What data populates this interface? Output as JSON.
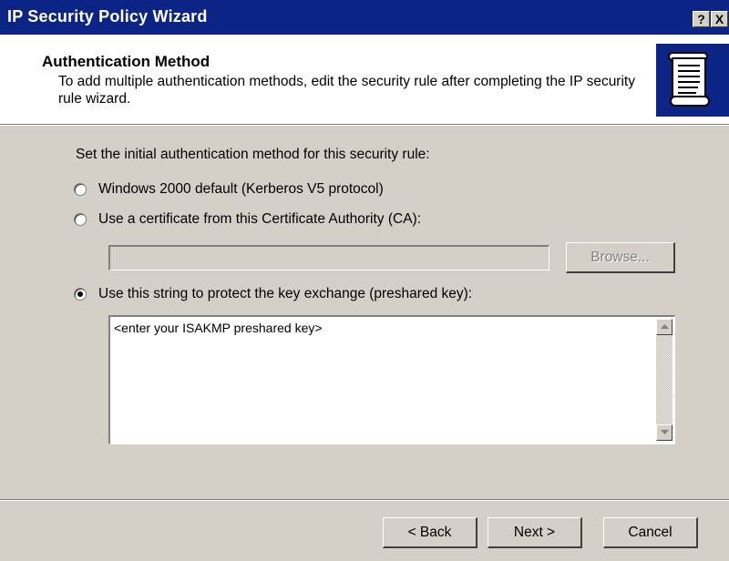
{
  "window": {
    "title": "IP Security Policy Wizard",
    "help_button": "?",
    "close_button": "X"
  },
  "header": {
    "title": "Authentication Method",
    "description": "To add multiple authentication methods, edit the security rule after completing the IP security rule wizard.",
    "icon": "scroll-document-icon"
  },
  "body": {
    "instruction": "Set the initial authentication method for this security rule:",
    "options": [
      {
        "label": "Windows 2000 default (Kerberos V5 protocol)",
        "selected": false
      },
      {
        "label": "Use a certificate from this Certificate Authority (CA):",
        "selected": false
      },
      {
        "label": "Use this string to protect the key exchange (preshared key):",
        "selected": true
      }
    ],
    "ca_field_value": "",
    "browse_label": "Browse...",
    "preshared_key_value": "<enter your ISAKMP preshared key>"
  },
  "footer": {
    "back_label": "< Back",
    "next_label": "Next >",
    "cancel_label": "Cancel"
  },
  "colors": {
    "titlebar": "#0b2486",
    "face": "#d4d0c8",
    "header_bg": "#ffffff"
  }
}
